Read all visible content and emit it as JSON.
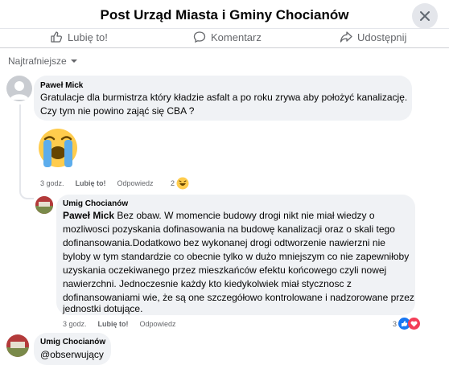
{
  "header": {
    "title": "Post Urząd Miasta i Gminy Chocianów"
  },
  "actions": {
    "like": "Lubię to!",
    "comment": "Komentarz",
    "share": "Udostępnij"
  },
  "sort": {
    "label": "Najtrafniejsze"
  },
  "comments": [
    {
      "author": "Paweł Mick",
      "text_lines": [
        "Gratulacje dla burmistrza który kładzie asfalt a po roku zrywa aby położyć kanalizację.",
        "Czy tym nie powino zająć się CBA ?"
      ],
      "time": "3 godz.",
      "like": "Lubię to!",
      "reply": "Odpowiedz",
      "reactions_count": "2",
      "sticker_icon": "crying-face-sticker",
      "reply_comment": {
        "author": "Umig Chocianów",
        "mention": "Paweł Mick",
        "text_first": " Bez obaw. W momencie budowy drogi nikt nie miał wiedzy o",
        "text_lines": [
          "mozliwosci pozyskania dofinasowania na budowę kanalizacji oraz o skali tego",
          "dofinansowania.Dodatkowo bez wykonanej drogi odtworzenie nawierzni nie",
          "byloby w tym standardzie co obecnie tylko w dużo mniejszym co nie zapewniłoby",
          "uzyskania oczekiwanego przez mieszkańców efektu końcowego czyli nowej",
          "nawierzchni. Jednoczesnie każdy kto kiedykolwiek miał stycznosc z",
          "dofinansowaniami wie, że są one szczegółowo kontrolowane i nadzorowane przez",
          "jednostki dotujące."
        ],
        "time": "3 godz.",
        "like": "Lubię to!",
        "reply": "Odpowiedz",
        "reactions_count": "3"
      }
    },
    {
      "author": "Umig Chocianów",
      "text": "@obserwujący"
    }
  ],
  "colors": {
    "like_blue": "#1877f2",
    "love_red": "#f33e58",
    "bubble": "#f0f2f5",
    "muted": "#65676b"
  }
}
